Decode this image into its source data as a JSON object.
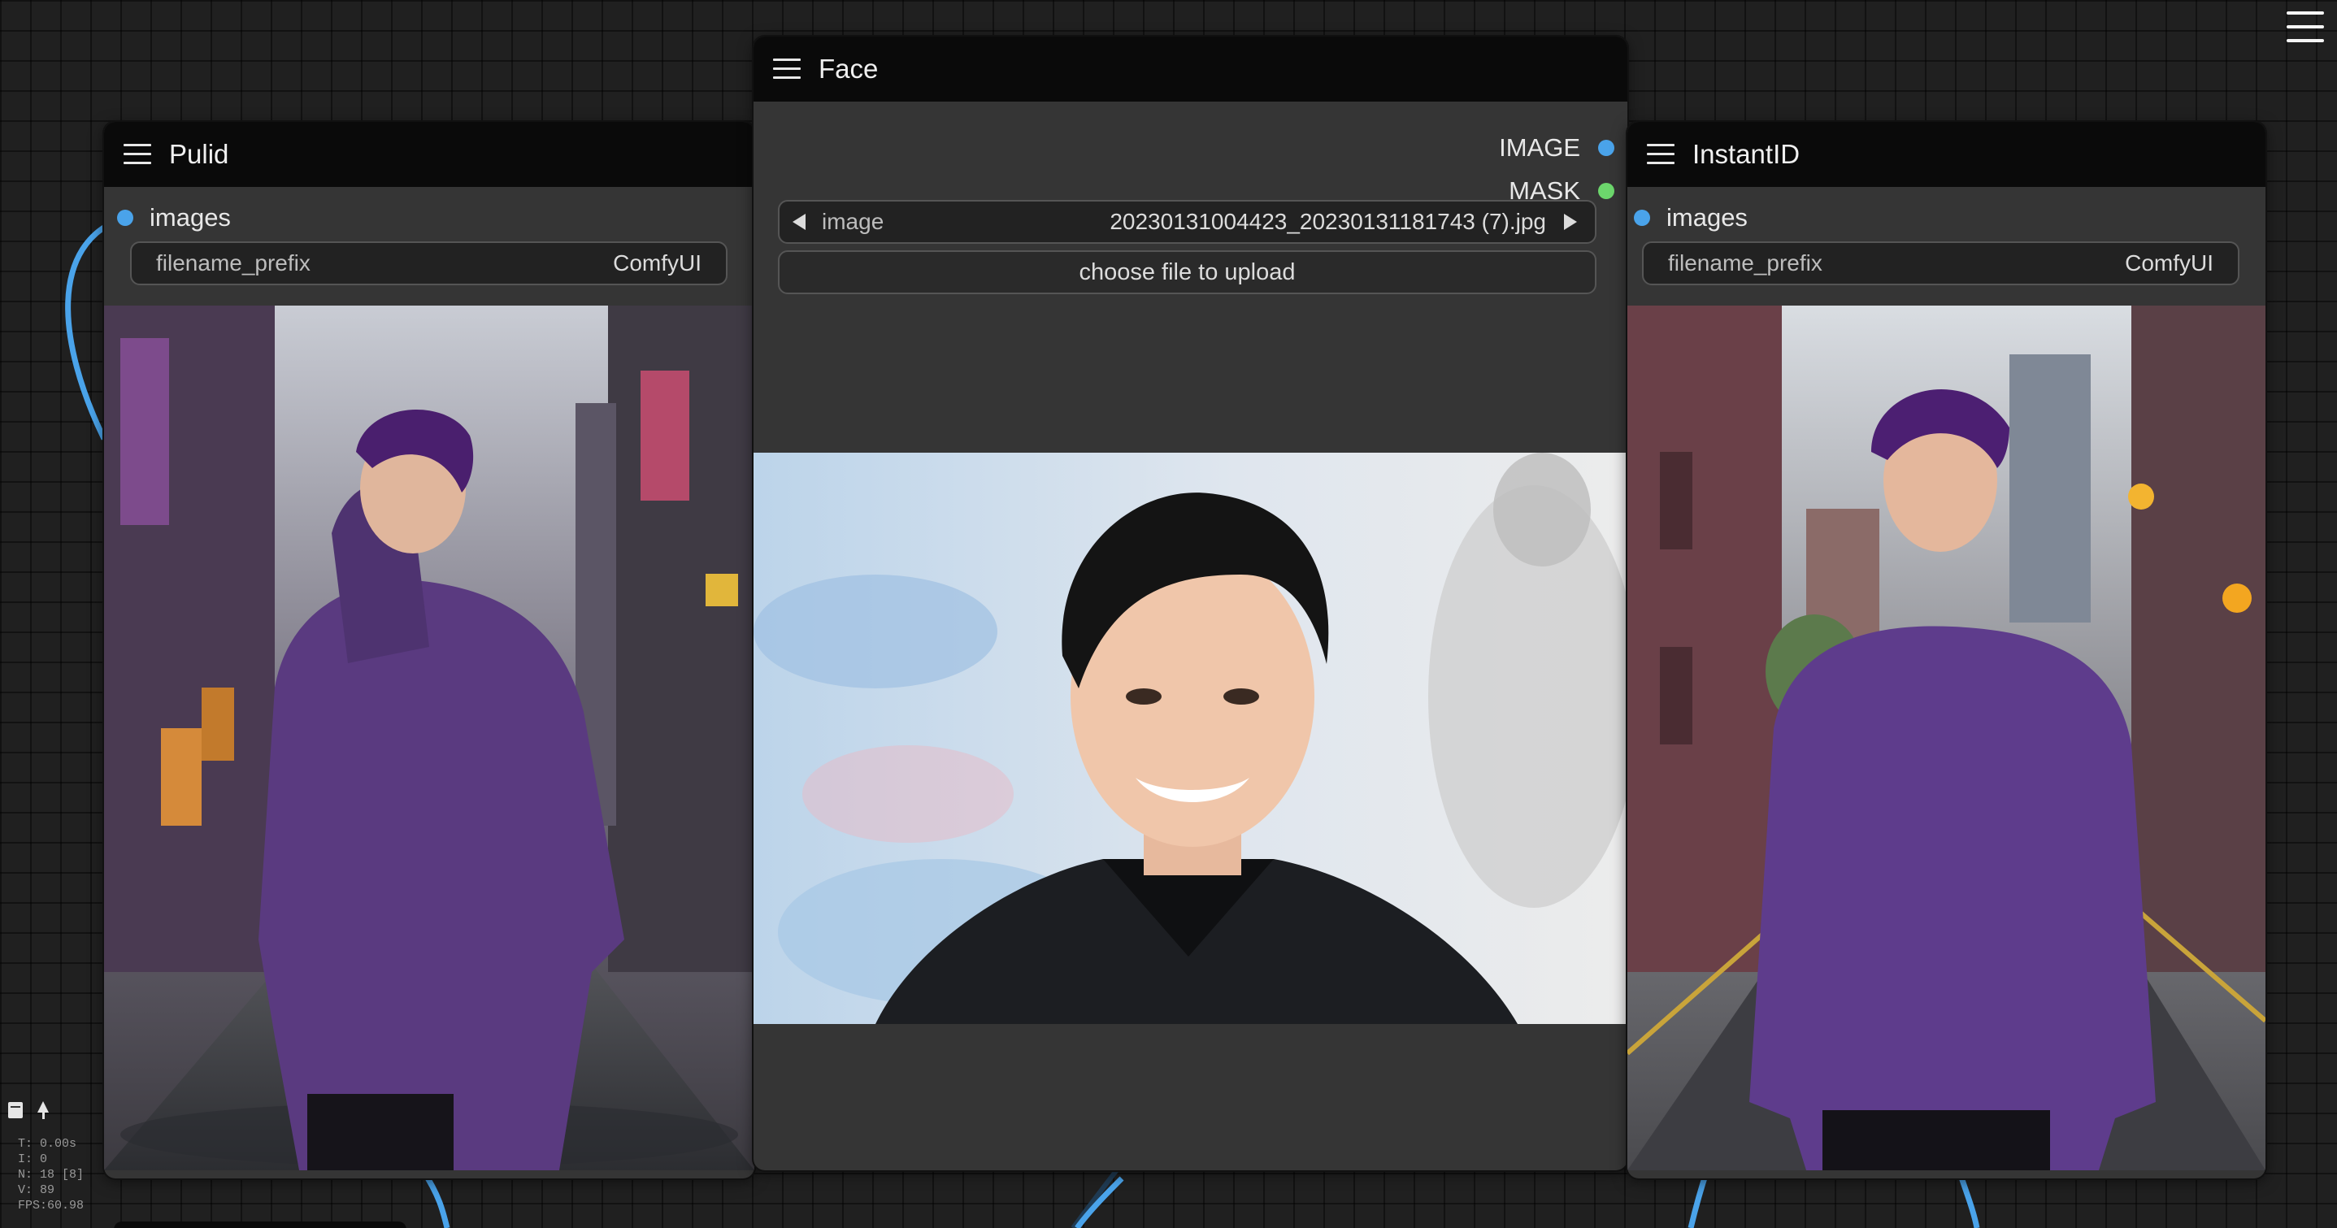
{
  "canvas": {
    "colors": {
      "background": "#202020",
      "link_blue": "#4aa3ea",
      "link_dark": "#1f3a52",
      "socket_green": "#6cd66c"
    }
  },
  "nodes": {
    "pulid": {
      "title": "Pulid",
      "input_label": "images",
      "widget": {
        "label": "filename_prefix",
        "value": "ComfyUI"
      }
    },
    "face": {
      "title": "Face",
      "outputs": [
        {
          "label": "IMAGE",
          "color": "#4aa3ea"
        },
        {
          "label": "MASK",
          "color": "#6cd66c"
        }
      ],
      "image_widget": {
        "label": "image",
        "value": "20230131004423_20230131181743 (7).jpg"
      },
      "upload_label": "choose file to upload"
    },
    "instantid": {
      "title": "InstantID",
      "input_label": "images",
      "widget": {
        "label": "filename_prefix",
        "value": "ComfyUI"
      }
    }
  },
  "stats": [
    "T: 0.00s",
    "I: 0",
    "N: 18 [8]",
    "V: 89",
    "FPS:60.98"
  ],
  "icons": {
    "node_menu": "hamburger-icon",
    "canvas_menu": "hamburger-icon",
    "stats_toggle": "panel-icon",
    "stats_pin": "pin-icon",
    "widget_prev": "arrow-left-icon",
    "widget_next": "arrow-right-icon"
  }
}
